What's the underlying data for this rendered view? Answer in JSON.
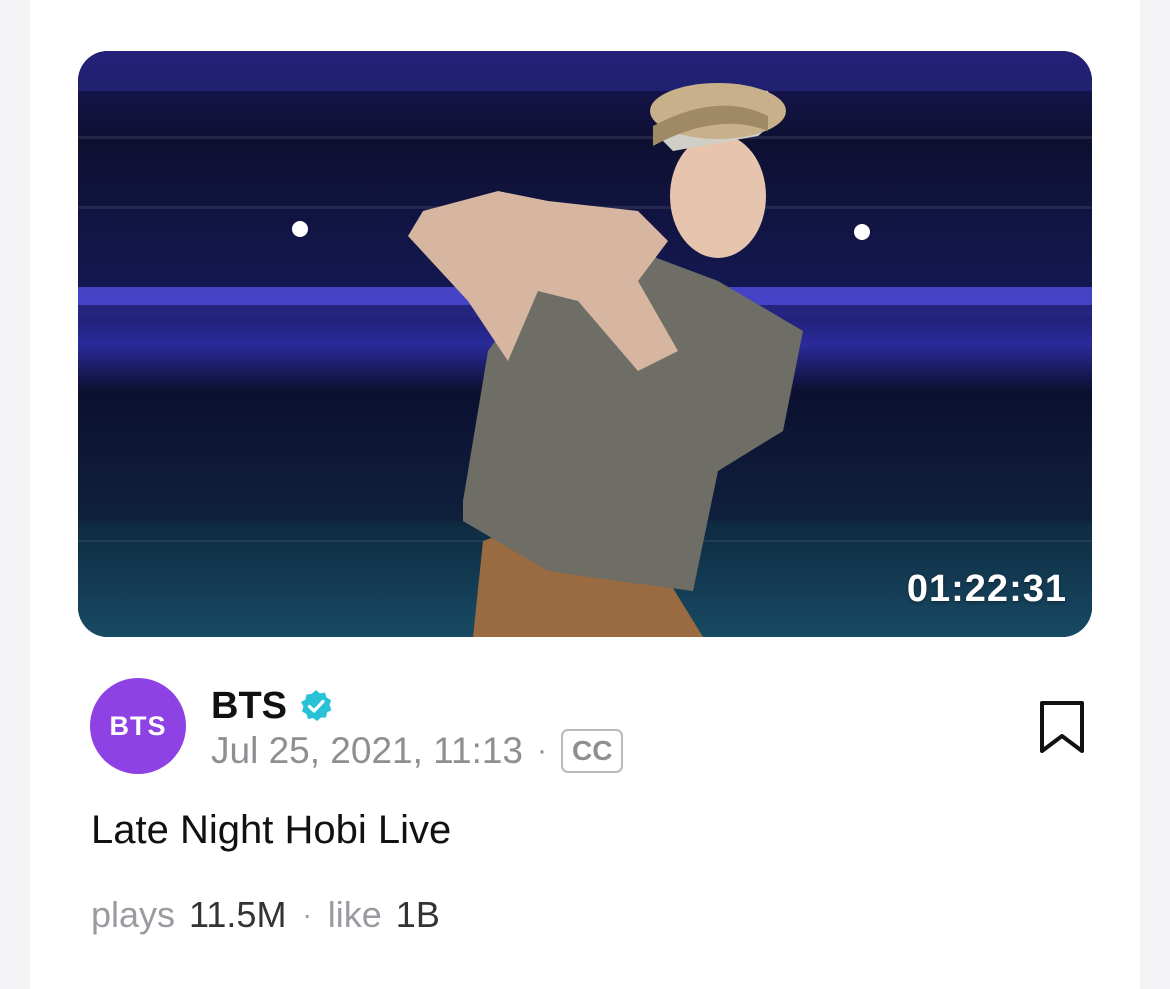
{
  "video": {
    "duration": "01:22:31",
    "title": "Late Night Hobi Live"
  },
  "channel": {
    "avatar_text": "BTS",
    "name": "BTS",
    "verified_icon": "verified-check-icon",
    "avatar_color": "#8f42e4",
    "verified_color": "#27c2d6"
  },
  "meta": {
    "date": "Jul 25, 2021, 11:13",
    "separator": "·",
    "cc_label": "CC"
  },
  "stats": {
    "plays_label": "plays",
    "plays_value": "11.5M",
    "separator": "·",
    "like_label": "like",
    "like_value": "1B"
  },
  "actions": {
    "bookmark_icon": "bookmark-icon"
  }
}
